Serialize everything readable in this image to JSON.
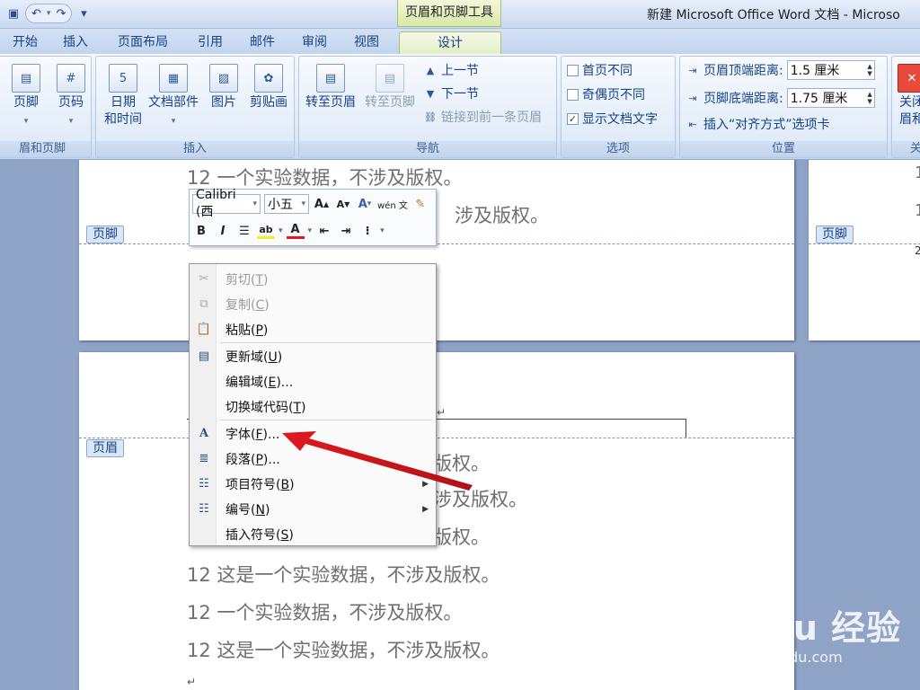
{
  "titlebar": {
    "context_tab_title": "页眉和页脚工具",
    "window_title": "新建 Microsoft Office Word 文档 - Microso"
  },
  "tabs": [
    "开始",
    "插入",
    "页面布局",
    "引用",
    "邮件",
    "审阅",
    "视图",
    "设计"
  ],
  "ribbon": {
    "group_hf": {
      "label": "眉和页脚",
      "footer": "页脚",
      "page_number": "页码"
    },
    "group_insert": {
      "label": "插入",
      "date_l1": "日期",
      "date_l2": "和时间",
      "docparts": "文档部件",
      "picture": "图片",
      "clipart": "剪贴画"
    },
    "group_nav": {
      "label": "导航",
      "goto_header": "转至页眉",
      "goto_footer": "转至页脚",
      "prev": "上一节",
      "next": "下一节",
      "link_prev": "链接到前一条页眉"
    },
    "group_options": {
      "label": "选项",
      "diff_first": "首页不同",
      "diff_odd_even": "奇偶页不同",
      "show_doc_text": "显示文档文字",
      "show_doc_text_checked": true
    },
    "group_position": {
      "label": "位置",
      "header_top": "页眉顶端距离:",
      "header_top_value": "1.5 厘米",
      "footer_bottom": "页脚底端距离:",
      "footer_bottom_value": "1.75 厘米",
      "insert_align_tab": "插入“对齐方式”选项卡"
    },
    "group_close": {
      "label": "关",
      "line1": "关闭",
      "line2": "眉和"
    }
  },
  "document": {
    "footer_tag": "页脚",
    "header_tag": "页眉",
    "page_a_line1": "12 一个实验数据，不涉及版权。",
    "page_a_line2": "涉及版权。",
    "page_c_lines": [
      "版权。",
      "涉及版权。",
      "版权。",
      "12 这是一个实验数据，不涉及版权。",
      "12 一个实验数据，不涉及版权。",
      "12 这是一个实验数据，不涉及版权。"
    ],
    "para_mark": "↵",
    "side_num_1": "1",
    "side_num_2": "1",
    "side_num_3": "2"
  },
  "mini_toolbar": {
    "font": "Calibri (西",
    "size": "小五",
    "grow": "A",
    "shrink": "A",
    "styles": "A",
    "phonetic": "wén 文",
    "bold": "B",
    "italic": "I",
    "highlight": "ab",
    "font_color": "A"
  },
  "context_menu": {
    "items": [
      {
        "label": "剪切",
        "key": "T"
      },
      {
        "label": "复制",
        "key": "C"
      },
      {
        "label": "粘贴",
        "key": "P"
      },
      {
        "label": "更新域",
        "key": "U"
      },
      {
        "label": "编辑域",
        "key": "E"
      },
      {
        "label": "切换域代码",
        "key": "T"
      },
      {
        "label": "字体",
        "key": "F"
      },
      {
        "label": "段落",
        "key": "P"
      },
      {
        "label": "项目符号",
        "key": "B"
      },
      {
        "label": "编号",
        "key": "N"
      },
      {
        "label": "插入符号",
        "key": "S"
      }
    ]
  },
  "watermark": {
    "main": "Baidu 经验",
    "sub": "jingyan.baidu.com"
  },
  "colors": {
    "accent": "#15428b",
    "arrow": "#e0191f",
    "design_tab": "#e2efc6"
  }
}
